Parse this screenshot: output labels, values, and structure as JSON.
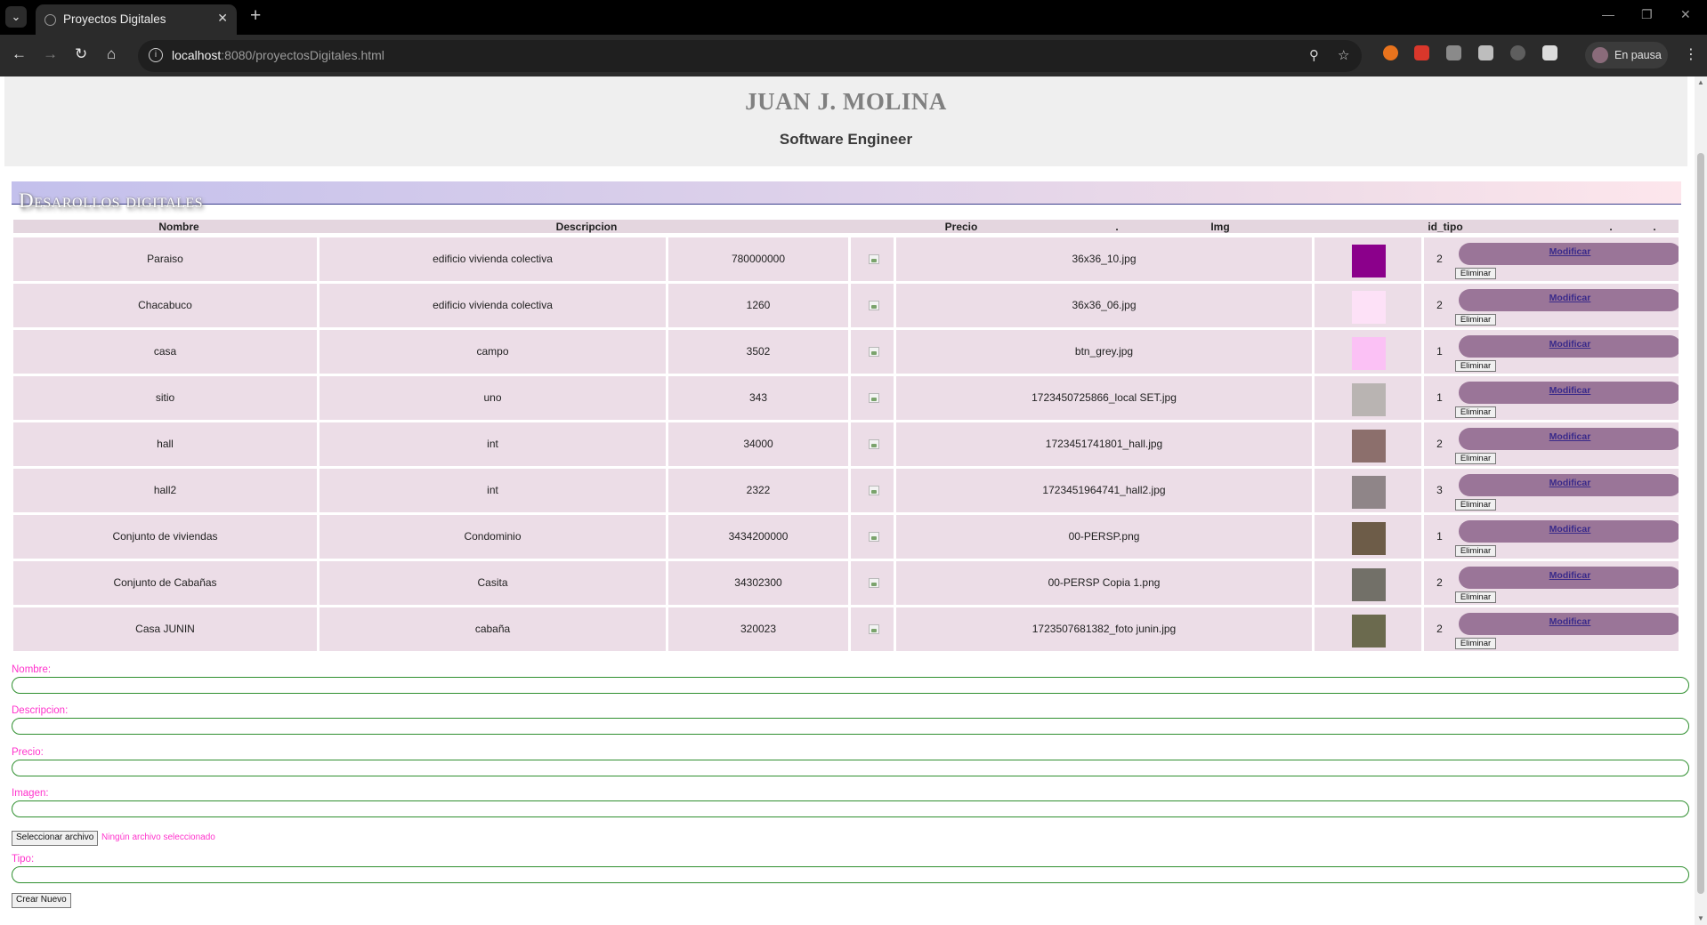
{
  "browser": {
    "tab_title": "Proyectos Digitales",
    "url_host": "localhost",
    "url_rest": ":8080/proyectosDigitales.html",
    "profile_label": "En pausa"
  },
  "header": {
    "name": "JUAN J. MOLINA",
    "role": "Software Engineer"
  },
  "section_title": "Desarollos digitales",
  "table": {
    "columns": [
      "Nombre",
      "Descripcion",
      "Precio",
      ".",
      "Img",
      "id_tipo",
      ".",
      "."
    ],
    "rows": [
      {
        "nombre": "Paraiso",
        "descripcion": "edificio vivienda colectiva",
        "precio": "780000000",
        "img": "36x36_10.jpg",
        "id_tipo": "2",
        "thumb_color": "#8b008b"
      },
      {
        "nombre": "Chacabuco",
        "descripcion": "edificio vivienda colectiva",
        "precio": "1260",
        "img": "36x36_06.jpg",
        "id_tipo": "2",
        "thumb_color": "#fde1f7"
      },
      {
        "nombre": "casa",
        "descripcion": "campo",
        "precio": "3502",
        "img": "btn_grey.jpg",
        "id_tipo": "1",
        "thumb_color": "#fbc1f5"
      },
      {
        "nombre": "sitio",
        "descripcion": "uno",
        "precio": "343",
        "img": "1723450725866_local SET.jpg",
        "id_tipo": "1",
        "thumb_color": "#b9b4b2"
      },
      {
        "nombre": "hall",
        "descripcion": "int",
        "precio": "34000",
        "img": "1723451741801_hall.jpg",
        "id_tipo": "2",
        "thumb_color": "#8c6f6c"
      },
      {
        "nombre": "hall2",
        "descripcion": "int",
        "precio": "2322",
        "img": "1723451964741_hall2.jpg",
        "id_tipo": "3",
        "thumb_color": "#8f8588"
      },
      {
        "nombre": "Conjunto de viviendas",
        "descripcion": "Condominio",
        "precio": "3434200000",
        "img": "00-PERSP.png",
        "id_tipo": "1",
        "thumb_color": "#6d5c48"
      },
      {
        "nombre": "Conjunto de Cabañas",
        "descripcion": "Casita",
        "precio": "34302300",
        "img": "00-PERSP Copia 1.png",
        "id_tipo": "2",
        "thumb_color": "#727068"
      },
      {
        "nombre": "Casa JUNIN",
        "descripcion": "cabaña",
        "precio": "320023",
        "img": "1723507681382_foto junin.jpg",
        "id_tipo": "2",
        "thumb_color": "#6b6a4e"
      }
    ],
    "modify_label": "Modificar",
    "delete_label": "Eliminar"
  },
  "form": {
    "nombre_label": "Nombre:",
    "descripcion_label": "Descripcion:",
    "precio_label": "Precio:",
    "imagen_label": "Imagen:",
    "file_button": "Seleccionar archivo",
    "file_status": "Ningún archivo seleccionado",
    "tipo_label": "Tipo:",
    "create_button": "Crear Nuevo"
  }
}
